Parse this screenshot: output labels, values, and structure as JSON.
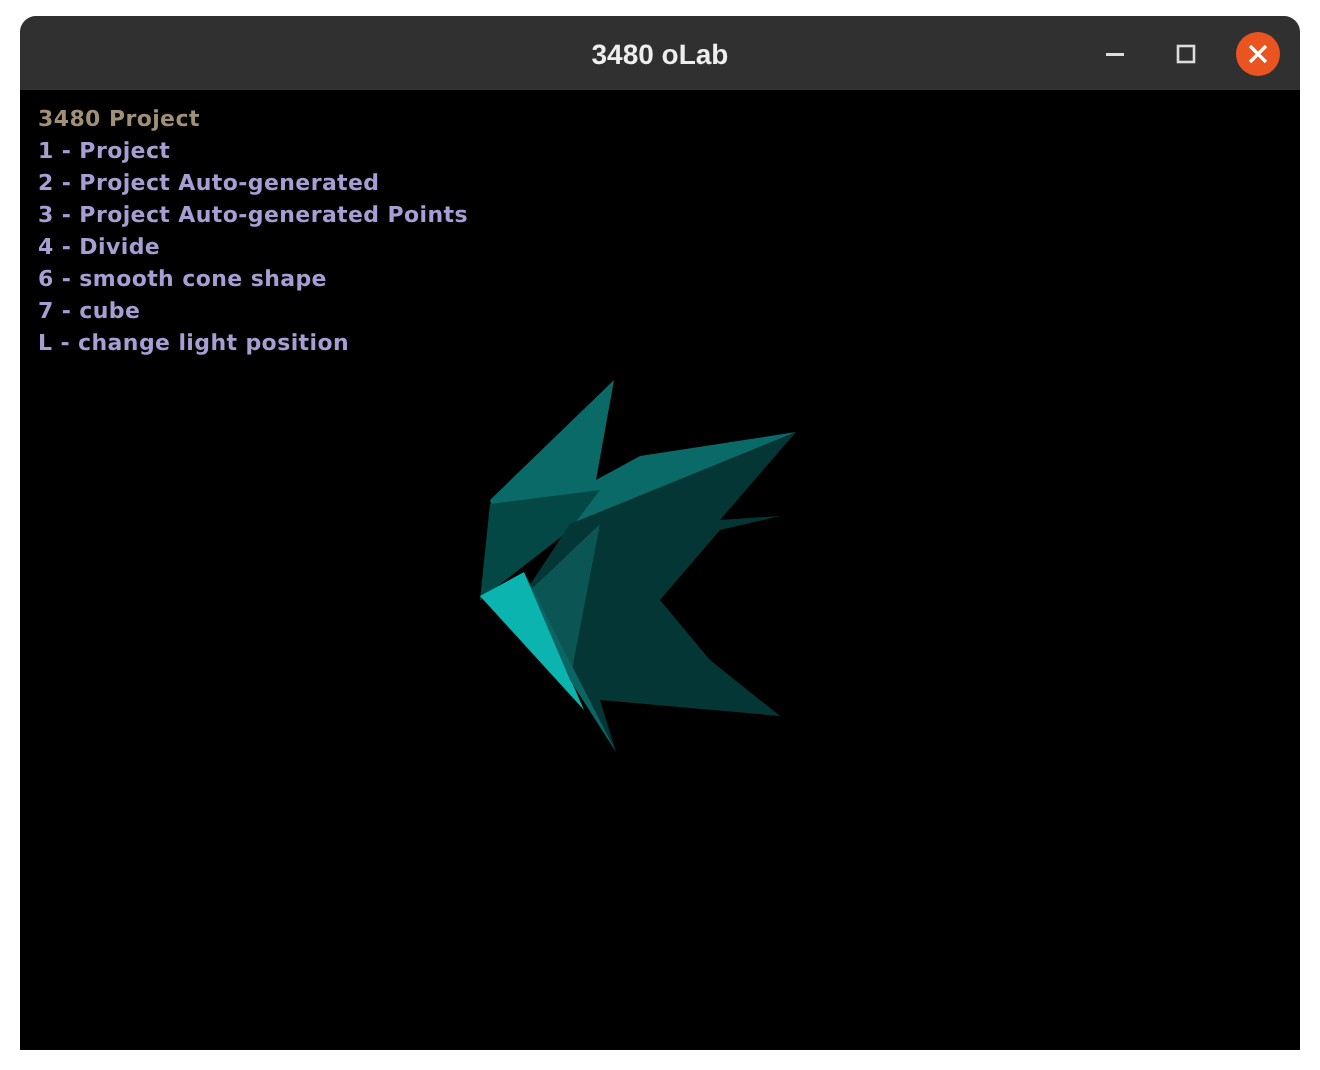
{
  "window": {
    "title": "3480 oLab"
  },
  "overlay_lines": [
    {
      "kind": "heading",
      "text": "3480 Project"
    },
    {
      "kind": "item",
      "text": "1 - Project"
    },
    {
      "kind": "item",
      "text": "2 - Project Auto-generated"
    },
    {
      "kind": "item",
      "text": "3 - Project Auto-generated Points"
    },
    {
      "kind": "item",
      "text": "4 - Divide"
    },
    {
      "kind": "item",
      "text": "6 - smooth cone shape"
    },
    {
      "kind": "item",
      "text": "7 - cube"
    },
    {
      "kind": "item",
      "text": "L - change light position"
    }
  ]
}
